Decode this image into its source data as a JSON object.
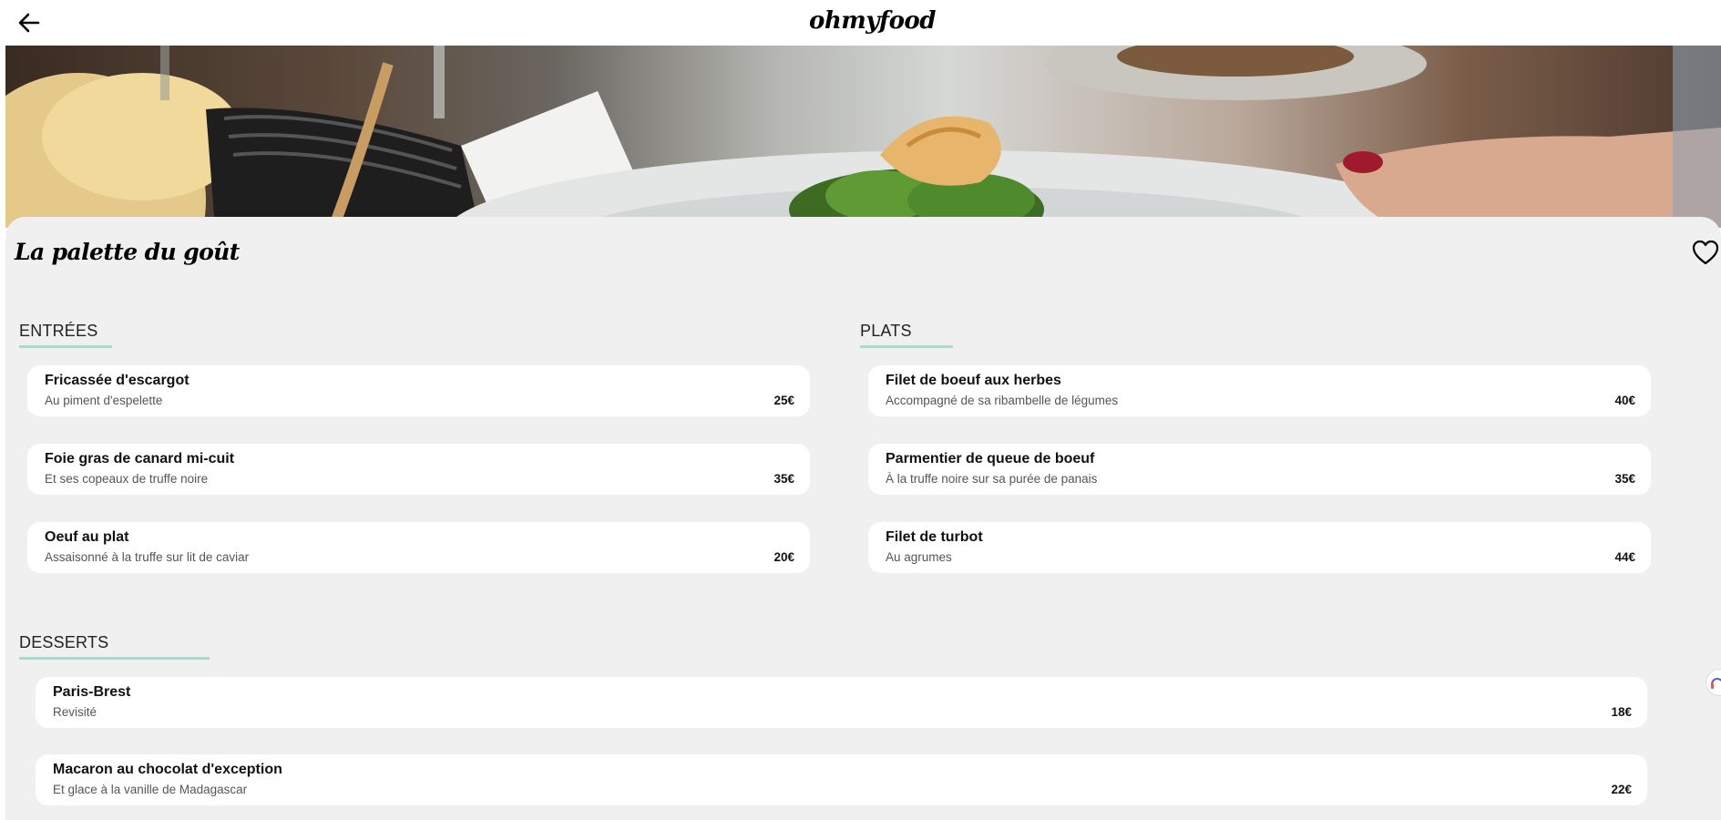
{
  "header": {
    "logo": "ohmyfood",
    "back_icon": "arrow-left-icon"
  },
  "restaurant": {
    "name": "La palette du goût",
    "favorite_icon": "heart-outline-icon"
  },
  "menu": {
    "entrees": {
      "title": "ENTRÉES",
      "items": [
        {
          "name": "Fricassée d'escargot",
          "description": "Au piment d'espelette",
          "price": "25€"
        },
        {
          "name": "Foie gras de canard mi-cuit",
          "description": "Et ses copeaux de truffe noire",
          "price": "35€"
        },
        {
          "name": "Oeuf au plat",
          "description": "Assaisonné à la truffe sur lit de caviar",
          "price": "20€"
        }
      ]
    },
    "plats": {
      "title": "PLATS",
      "items": [
        {
          "name": "Filet de boeuf aux herbes",
          "description": "Accompagné de sa ribambelle de légumes",
          "price": "40€"
        },
        {
          "name": "Parmentier de queue de boeuf",
          "description": "À la truffe noire sur sa purée de panais",
          "price": "35€"
        },
        {
          "name": "Filet de turbot",
          "description": "Au agrumes",
          "price": "44€"
        }
      ]
    },
    "desserts": {
      "title": "DESSERTS",
      "items": [
        {
          "name": "Paris-Brest",
          "description": "Revisité",
          "price": "18€"
        },
        {
          "name": "Macaron au chocolat d'exception",
          "description": "Et glace à la vanille de Madagascar",
          "price": "22€"
        }
      ]
    }
  },
  "colors": {
    "accent_underline": "#99e2d0",
    "content_background": "#f0f0f0",
    "card_background": "#ffffff"
  }
}
